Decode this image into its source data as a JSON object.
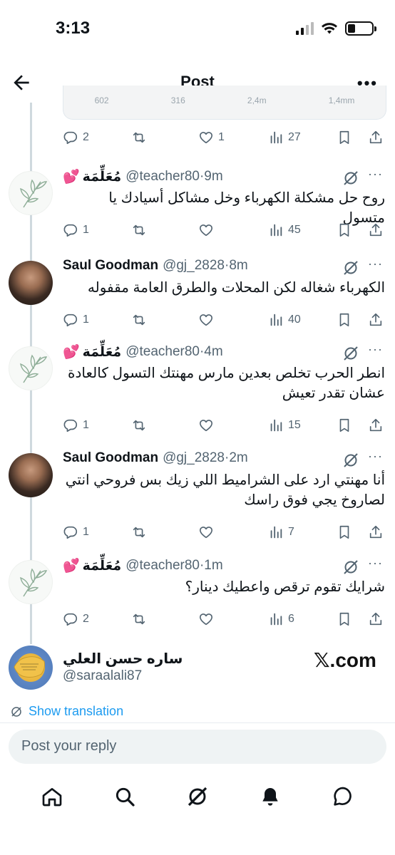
{
  "status_bar": {
    "time": "3:13"
  },
  "header": {
    "title": "Post",
    "more": "•••"
  },
  "quoted_card": {
    "stats": [
      "602",
      "316",
      "2,4m",
      "1,4mm"
    ]
  },
  "top_actions": {
    "reply_count": "2",
    "like_count": "1",
    "views_count": "27"
  },
  "replies": [
    {
      "name": "مُعَلِّمَة",
      "emoji": "💕",
      "handle": "@teacher80",
      "time": "·9m",
      "text": "روح حل مشكلة الكهرباء وخل مشاكل أسيادك يا متسول",
      "reply_count": "1",
      "views_count": "45",
      "avatar": "plant"
    },
    {
      "name": "Saul Goodman",
      "emoji": "",
      "handle": "@gj_2828",
      "time": "·8m",
      "text": "الكهرباء شغاله لكن المحلات والطرق العامة مقفوله",
      "reply_count": "1",
      "views_count": "40",
      "avatar": "saul"
    },
    {
      "name": "مُعَلِّمَة",
      "emoji": "💕",
      "handle": "@teacher80",
      "time": "·4m",
      "text": "انطر الحرب تخلص بعدين مارس مهنتك التسول كالعادة عشان تقدر تعيش",
      "reply_count": "1",
      "views_count": "15",
      "avatar": "plant"
    },
    {
      "name": "Saul Goodman",
      "emoji": "",
      "handle": "@gj_2828",
      "time": "·2m",
      "text": "أنا مهنتي ارد على الشراميط اللي زيك بس فروحي انتي لصاروخ يجي فوق راسك",
      "reply_count": "1",
      "views_count": "7",
      "avatar": "saul"
    },
    {
      "name": "مُعَلِّمَة",
      "emoji": "💕",
      "handle": "@teacher80",
      "time": "·1m",
      "text": "شرايك تقوم ترقص واعطيك دينار؟",
      "reply_count": "2",
      "views_count": "6",
      "avatar": "plant"
    }
  ],
  "source": {
    "name": "ساره حسن العلي",
    "handle": "@saraalali87",
    "logo": "𝕏.com"
  },
  "translation": {
    "label": "Show translation"
  },
  "reply_box": {
    "placeholder": "Post your reply"
  },
  "colors": {
    "accent": "#1d9bf0",
    "text": "#0f1419",
    "muted": "#536471",
    "emoji_heart": "#ff4fa0"
  },
  "tabs": [
    "home-icon",
    "search-icon",
    "grok-icon",
    "notifications-icon",
    "messages-icon"
  ]
}
